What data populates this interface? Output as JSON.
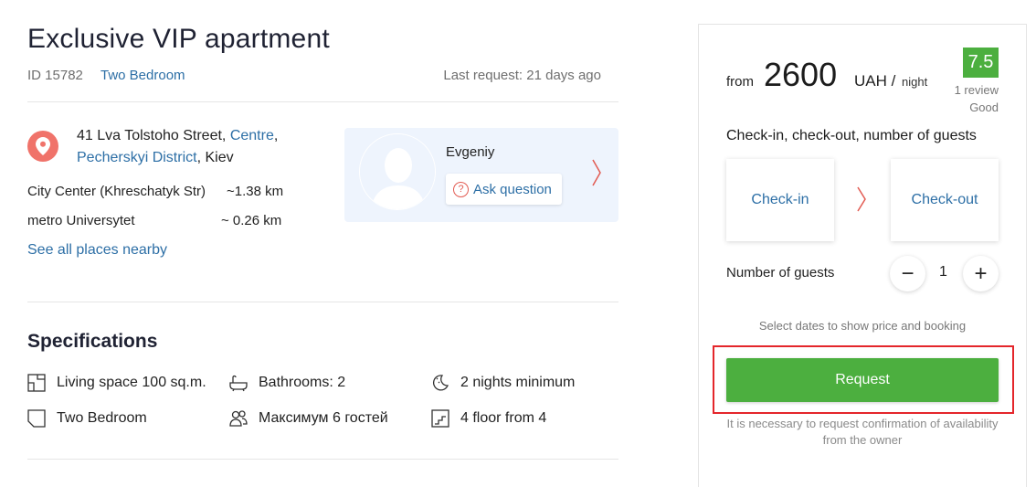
{
  "listing": {
    "title": "Exclusive VIP apartment",
    "id_label": "ID 15782",
    "type": "Two Bedroom",
    "last_request": "Last request: 21 days ago"
  },
  "address": {
    "street": "41 Lva Tolstoho Street, ",
    "area": "Centre",
    "comma": ",",
    "district": "Pecherskyi District",
    "city": ", Kiev"
  },
  "places": [
    {
      "name": "City Center (Khreschatyk Str)",
      "distance": "~1.38 km"
    },
    {
      "name": "metro Universytet",
      "distance": "~ 0.26 km"
    }
  ],
  "see_all": "See all places nearby",
  "host": {
    "name": "Evgeniy",
    "ask_label": "Ask question"
  },
  "specs": {
    "title": "Specifications",
    "items": [
      {
        "icon": "floor-plan-icon",
        "label": "Living space 100 sq.m."
      },
      {
        "icon": "bathtub-icon",
        "label": "Bathrooms: 2"
      },
      {
        "icon": "moon-icon",
        "label": "2 nights minimum"
      },
      {
        "icon": "room-icon",
        "label": "Two Bedroom"
      },
      {
        "icon": "people-icon",
        "label": "Максимум 6 гостей"
      },
      {
        "icon": "stairs-icon",
        "label": "4 floor from 4"
      }
    ]
  },
  "booking": {
    "from": "from",
    "price": "2600",
    "currency": "UAH /",
    "per": "night",
    "score": "7.5",
    "reviews": "1 review",
    "rating_word": "Good",
    "dates_label": "Check-in, check-out, number of guests",
    "checkin": "Check-in",
    "checkout": "Check-out",
    "guests_label": "Number of guests",
    "minus": "−",
    "guests": "1",
    "plus": "+",
    "select_note": "Select dates to show price and booking",
    "request_label": "Request",
    "confirm_note": "It is necessary to request confirmation of availability from the owner"
  },
  "colors": {
    "link": "#2d6fa6",
    "accent_green": "#4caf3f",
    "pin": "#f0736a",
    "highlight_red": "#e4262b"
  }
}
